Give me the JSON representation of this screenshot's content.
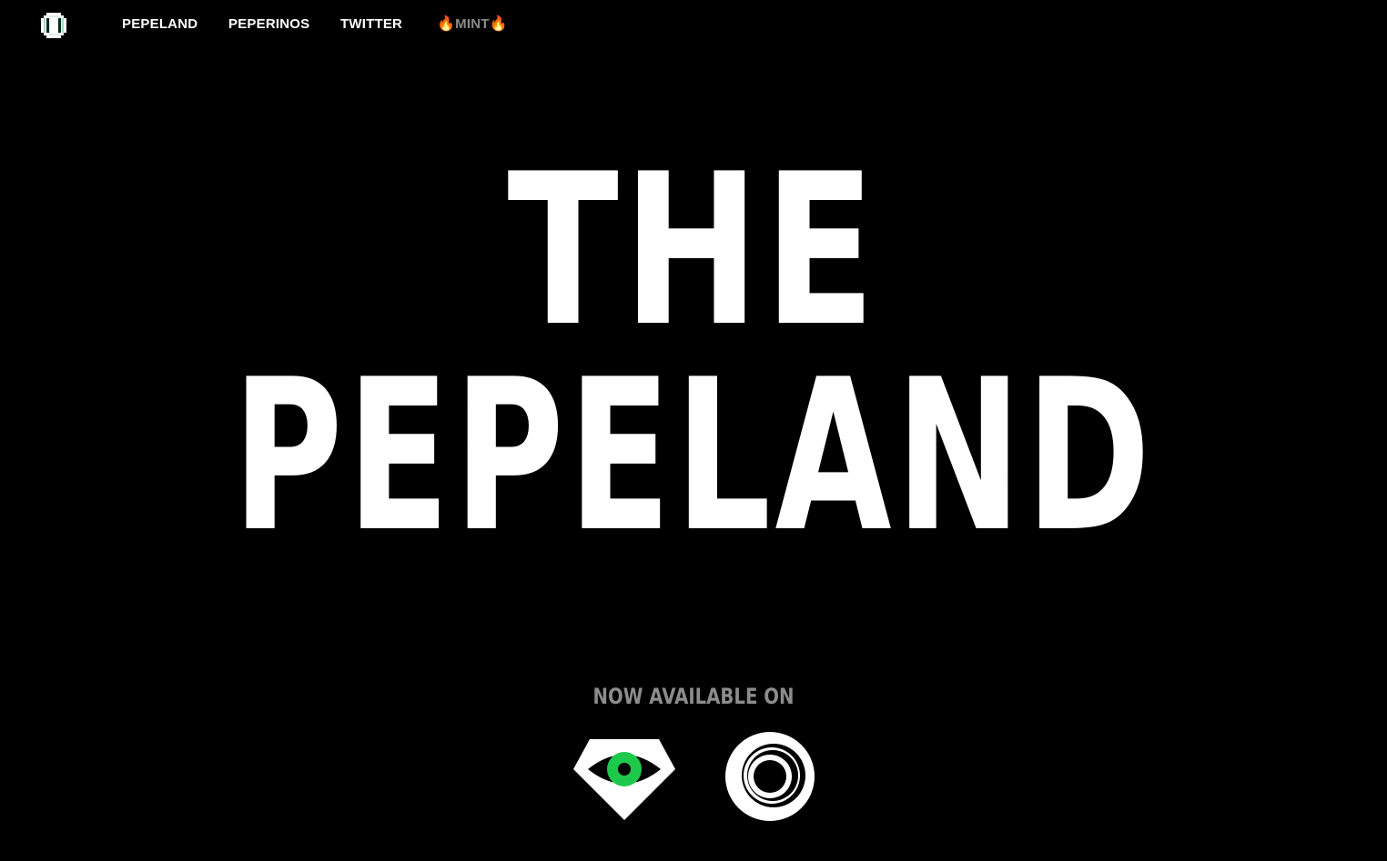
{
  "nav": {
    "logo_icon": "pixel-coin-icon",
    "items": [
      {
        "label": "PEPELAND"
      },
      {
        "label": "PEPERINOS"
      },
      {
        "label": "TWITTER"
      }
    ],
    "mint": {
      "label": "MINT",
      "fire_icon": "🔥",
      "color": "#8a8a8a"
    }
  },
  "hero": {
    "line1": "THE",
    "line2": "PEPELAND"
  },
  "available": {
    "label": "NOW AVAILABLE ON",
    "marketplaces": [
      {
        "icon": "eye-marketplace-icon",
        "accent": "#1ec84b"
      },
      {
        "icon": "ring-marketplace-icon"
      }
    ]
  },
  "colors": {
    "background": "#000000",
    "text": "#ffffff",
    "muted": "#8c8c8c",
    "accent_green": "#1ec84b"
  }
}
